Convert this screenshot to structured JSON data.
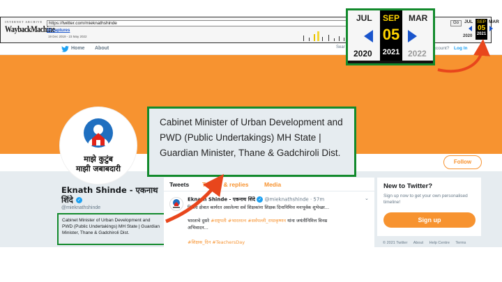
{
  "colors": {
    "accent": "#f79330",
    "highlight_border": "#128a2c",
    "twitter_blue": "#1da1f2",
    "page_bg": "#e6ecf0"
  },
  "wayback": {
    "brand_small": "INTERNET ARCHIVE",
    "brand_logo": "WaybackMachine",
    "url": "https://twitter.com/mieknathshinde",
    "captures": "10 captures",
    "date_range": "19 Dec 2019 - 23 May 2022",
    "go_label": "Go",
    "mini_calendar": {
      "prev_month": "JUL",
      "month": "SEP",
      "next_month": "MAR",
      "day": "05",
      "prev_year": "2020",
      "year": "2021"
    }
  },
  "calendar_zoom": {
    "prev_month": "JUL",
    "month": "SEP",
    "next_month": "MAR",
    "day": "05",
    "prev_year": "2020",
    "year": "2021",
    "next_year": "2022"
  },
  "twitter_nav": {
    "home": "Home",
    "about": "About",
    "search": "Sear",
    "account": "account?",
    "login": "Log In"
  },
  "avatar": {
    "line1": "माझे कुटुंब",
    "line2": "माझी जबाबदारी"
  },
  "callout": {
    "text": "Cabinet Minister of Urban Development and PWD (Public Undertakings) MH State | Guardian Minister, Thane & Gadchiroli Dist."
  },
  "profile": {
    "name": "Eknath Shinde - एकनाथ शिंदे",
    "verified_glyph": "✓",
    "handle": "@mieknathshinde",
    "bio": "Cabinet Minister of Urban Development and PWD (Public Undertakings) MH State | Guardian Minister, Thane & Gadchiroli Dist.",
    "follow": "Follow"
  },
  "timeline": {
    "tabs": [
      "Tweets",
      "Tweets & replies",
      "Media"
    ],
    "tweet": {
      "name": "Eknath Shinde - एकनाथ शिंदे",
      "handle": "@mieknathshinde · 57m",
      "line1": "विविध क्षेत्रात कार्यरत असलेल्या सर्व शिक्षकांना शिक्षक दिनानिमित्त मनःपूर्वक शुभेच्छा...",
      "line2_plain": "भारताचे दुसरे",
      "line2_tags": "#राष्ट्रपती #भारतरत्न #सर्वपल्ली_राधाकृष्णन",
      "line2_rest": "यांना जयंतीनिमित्त विनम्र",
      "line3": "अभिवादन...",
      "tags": "#शिक्षक_दिन #TeachersDay"
    }
  },
  "sidebar": {
    "title": "New to Twitter?",
    "text": "Sign up now to get your own personalised timeline!",
    "signup": "Sign up"
  },
  "footer": {
    "items": [
      "© 2021 Twitter",
      "About",
      "Help Centre",
      "Terms"
    ]
  }
}
